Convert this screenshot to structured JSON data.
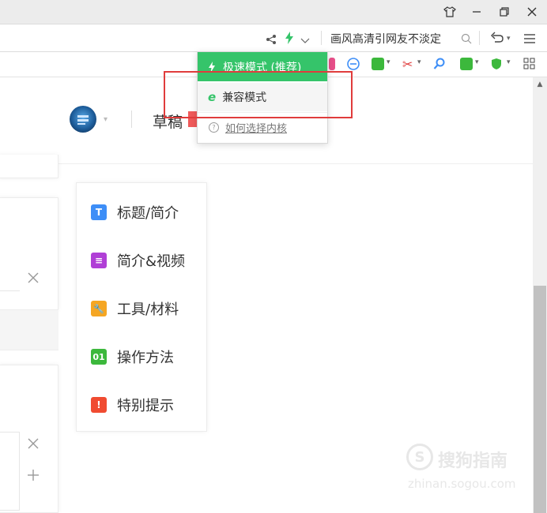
{
  "address_bar": {
    "hot_search": "画风高清引网友不淡定"
  },
  "engine_menu": {
    "fast_mode": "极速模式 (推荐)",
    "compat_mode": "兼容模式",
    "help": "如何选择内核"
  },
  "page": {
    "draft_label": "草稿"
  },
  "side_nav": {
    "items": [
      {
        "label": "标题/简介",
        "icon_text": "T",
        "color": "#3d8ef7"
      },
      {
        "label": "简介&视频",
        "icon_text": "≡",
        "color": "#b03fd6"
      },
      {
        "label": "工具/材料",
        "icon_text": "🔧",
        "color": "#f5a623"
      },
      {
        "label": "操作方法",
        "icon_text": "01",
        "color": "#3cb83c"
      },
      {
        "label": "特别提示",
        "icon_text": "!",
        "color": "#f04b31"
      }
    ]
  },
  "watermark": {
    "brand": "搜狗指南",
    "url": "zhinan.sogou.com"
  },
  "colors": {
    "fast_mode_green": "#35c46a",
    "highlight_red": "#e03c3c"
  }
}
